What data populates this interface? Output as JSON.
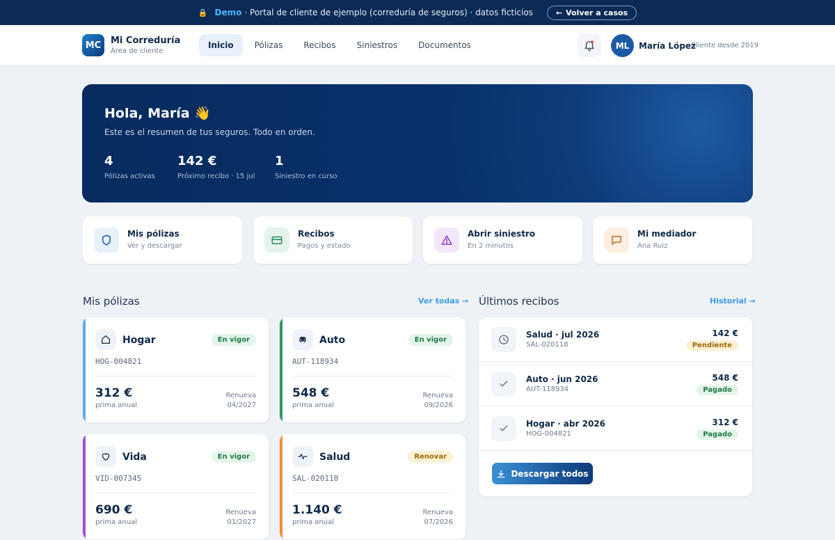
{
  "demo_bar": {
    "lock_icon": "lock-icon",
    "label": "Demo",
    "text": "· Portal de cliente de ejemplo (correduría de seguros) · datos ficticios",
    "back_label": "Volver a casos"
  },
  "header": {
    "logo": "MC",
    "brand": "Mi Correduría",
    "brand_sub": "Área de cliente",
    "nav": [
      "Inicio",
      "Pólizas",
      "Recibos",
      "Siniestros",
      "Documentos"
    ],
    "active_nav": "Inicio",
    "user_initials": "ML",
    "user_name": "María López",
    "user_since": "Cliente desde 2019"
  },
  "hero": {
    "title": "Hola, María 👋",
    "subtitle": "Este es el resumen de tus seguros. Todo en orden.",
    "stats": [
      {
        "value": "4",
        "label": "Pólizas activas"
      },
      {
        "value": "142 €",
        "label": "Próximo recibo · 15 jul"
      },
      {
        "value": "1",
        "label": "Siniestro en curso"
      }
    ]
  },
  "quick_actions": [
    {
      "title": "Mis pólizas",
      "sub": "Ver y descargar",
      "icon": "shield-icon",
      "color": "#1c5aa6"
    },
    {
      "title": "Recibos",
      "sub": "Pagos y estado",
      "icon": "card-icon",
      "color": "#1f8a5b"
    },
    {
      "title": "Abrir siniestro",
      "sub": "En 2 minutos",
      "icon": "warning-icon",
      "color": "#8a3cc7"
    },
    {
      "title": "Mi mediador",
      "sub": "Ana Ruiz",
      "icon": "chat-icon",
      "color": "#d0651c"
    }
  ],
  "policies_section": {
    "title": "Mis pólizas",
    "link": "Ver todas →"
  },
  "policies": [
    {
      "name": "Hogar",
      "icon": "home-icon",
      "status": "En vigor",
      "code": "HOG-004821",
      "amount": "312 €",
      "amount_label": "prima anual",
      "renew_label": "Renueva",
      "renew_date": "04/2027",
      "accent": "#5aaee8"
    },
    {
      "name": "Auto",
      "icon": "car-icon",
      "status": "En vigor",
      "code": "AUT-118934",
      "amount": "548 €",
      "amount_label": "prima anual",
      "renew_label": "Renueva",
      "renew_date": "09/2026",
      "accent": "#2e9a63"
    },
    {
      "name": "Vida",
      "icon": "heart-icon",
      "status": "En vigor",
      "code": "VID-007345",
      "amount": "690 €",
      "amount_label": "prima anual",
      "renew_label": "Renueva",
      "renew_date": "01/2027",
      "accent": "#9a4fd6"
    },
    {
      "name": "Salud",
      "icon": "pulse-icon",
      "status": "Renovar",
      "code": "SAL-020118",
      "amount": "1.140 €",
      "amount_label": "prima anual",
      "renew_label": "Renueva",
      "renew_date": "07/2026",
      "accent": "#ef8f36"
    }
  ],
  "receipts_section": {
    "title": "Últimos recibos",
    "link": "Historial →"
  },
  "receipts": [
    {
      "title": "Salud · jul 2026",
      "code": "SAL-020118",
      "amount": "142 €",
      "status": "Pendiente",
      "icon": "clock-icon"
    },
    {
      "title": "Auto · jun 2026",
      "code": "AUT-118934",
      "amount": "548 €",
      "status": "Pagado",
      "icon": "check-icon"
    },
    {
      "title": "Hogar · abr 2026",
      "code": "HOG-004821",
      "amount": "312 €",
      "status": "Pagado",
      "icon": "check-icon"
    }
  ],
  "download_label": "Descargar todos"
}
